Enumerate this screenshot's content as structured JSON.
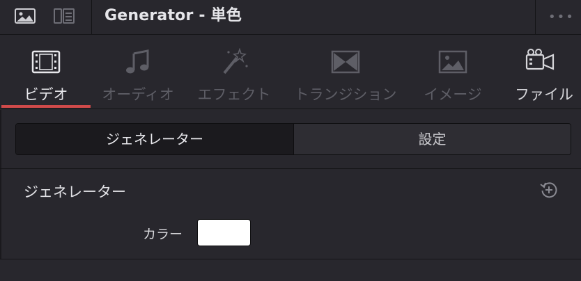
{
  "header": {
    "title": "Generator - 単色",
    "more": "•••"
  },
  "tabs": [
    {
      "label": "ビデオ",
      "icon": "film-icon",
      "state": "active"
    },
    {
      "label": "オーディオ",
      "icon": "music-note-icon",
      "state": "inactive"
    },
    {
      "label": "エフェクト",
      "icon": "magic-wand-icon",
      "state": "inactive"
    },
    {
      "label": "トランジション",
      "icon": "transition-icon",
      "state": "inactive"
    },
    {
      "label": "イメージ",
      "icon": "image-icon",
      "state": "inactive"
    },
    {
      "label": "ファイル",
      "icon": "camera-icon",
      "state": "normal"
    }
  ],
  "segment": {
    "left_label": "ジェネレーター",
    "right_label": "設定",
    "selected": "left"
  },
  "generator": {
    "section_title": "ジェネレーター",
    "color_label": "カラー",
    "color_value": "#ffffff"
  },
  "colors": {
    "accent": "#d04a4a",
    "background": "#28272d"
  }
}
